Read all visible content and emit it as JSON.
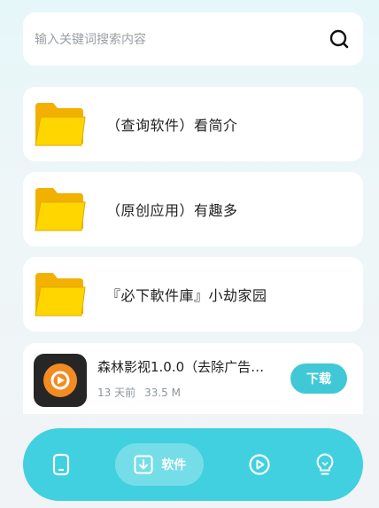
{
  "search": {
    "placeholder": "输入关键词搜索内容",
    "icon": "search-icon"
  },
  "folders": [
    {
      "label": "（查询软件）看简介",
      "icon": "folder-icon"
    },
    {
      "label": "（原创应用）有趣多",
      "icon": "folder-icon"
    },
    {
      "label": "『必下軟件庫』小劫家园",
      "icon": "folder-icon"
    }
  ],
  "app": {
    "title": "森林影视1.0.0（去除广告…",
    "time": "13 天前",
    "size": "33.5 M",
    "download_label": "下载",
    "icon": "play-app-icon"
  },
  "nav": {
    "items": [
      {
        "icon": "phone-icon"
      },
      {
        "icon": "download-icon",
        "label": "软件",
        "active": true
      },
      {
        "icon": "play-icon"
      },
      {
        "icon": "lightbulb-icon"
      }
    ]
  },
  "colors": {
    "accent": "#41d0df",
    "folder": "#ffd600",
    "folder_back": "#f4b400"
  }
}
